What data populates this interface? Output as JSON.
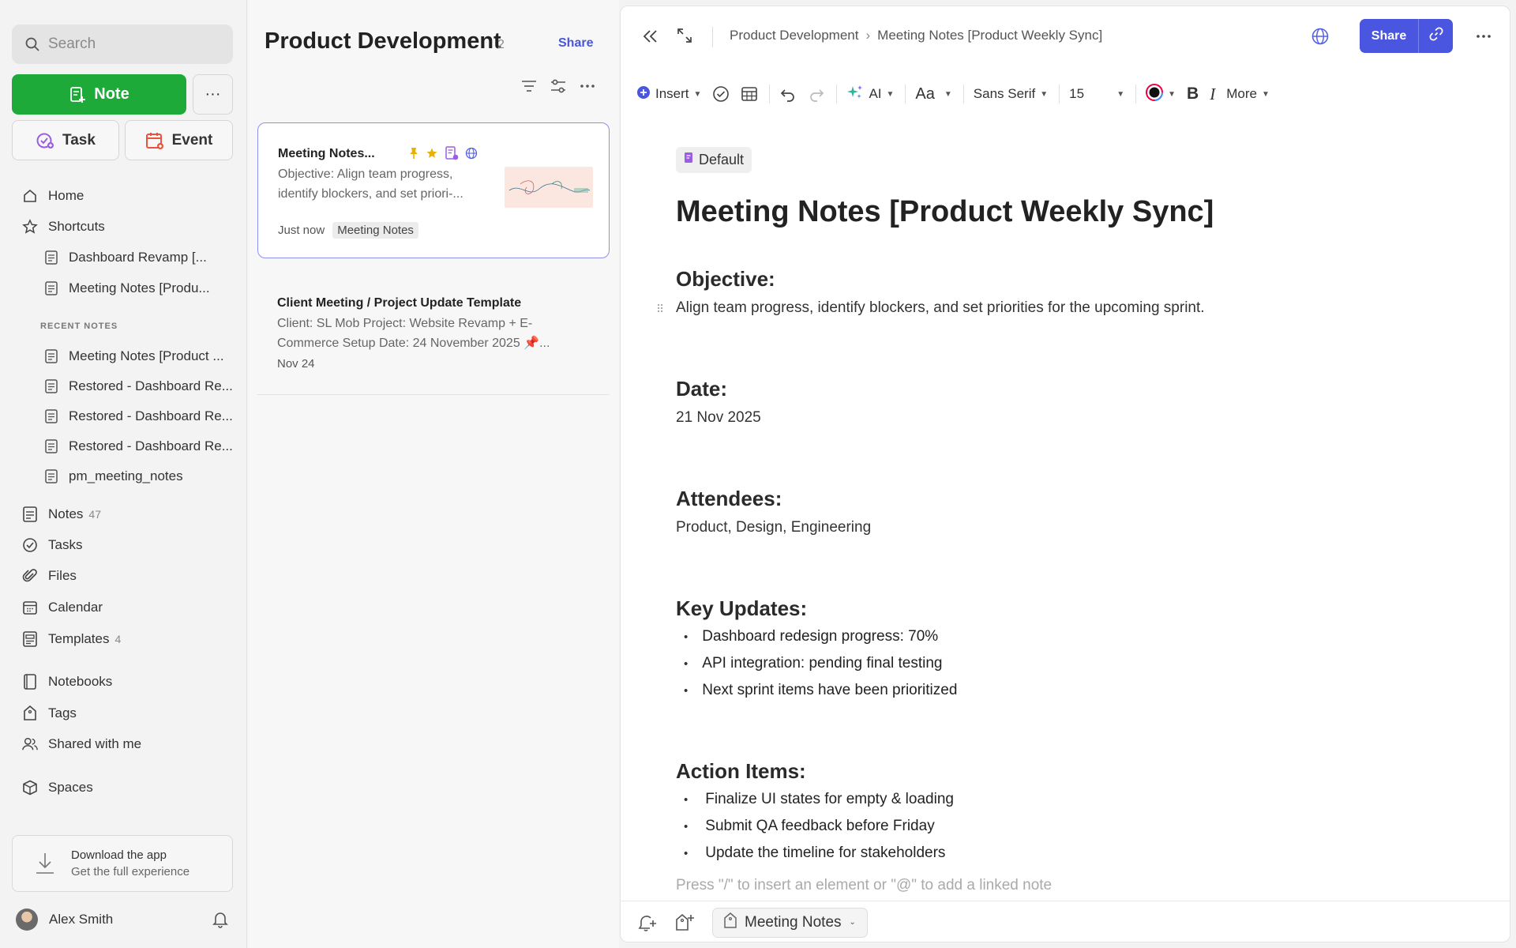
{
  "sidebar": {
    "search_placeholder": "Search",
    "note_button": "Note",
    "more_button": "···",
    "task_button": "Task",
    "event_button": "Event",
    "nav_top": [
      {
        "label": "Home",
        "icon": "home-icon"
      },
      {
        "label": "Shortcuts",
        "icon": "star-icon"
      }
    ],
    "shortcuts": [
      "Dashboard Revamp [...",
      "Meeting Notes [Produ..."
    ],
    "recent_title": "RECENT NOTES",
    "recent": [
      "Meeting Notes [Product ...",
      "Restored - Dashboard Re...",
      "Restored - Dashboard Re...",
      "Restored - Dashboard Re...",
      "pm_meeting_notes"
    ],
    "nav_main": [
      {
        "label": "Notes",
        "count": "47",
        "icon": "notes-icon"
      },
      {
        "label": "Tasks",
        "count": "",
        "icon": "task-check-icon"
      },
      {
        "label": "Files",
        "count": "",
        "icon": "paperclip-icon"
      },
      {
        "label": "Calendar",
        "count": "",
        "icon": "calendar-icon"
      },
      {
        "label": "Templates",
        "count": "4",
        "icon": "template-icon"
      }
    ],
    "nav_bottom": [
      {
        "label": "Notebooks",
        "icon": "notebook-icon"
      },
      {
        "label": "Tags",
        "icon": "tag-icon"
      },
      {
        "label": "Shared with me",
        "icon": "people-icon"
      },
      {
        "label": "Spaces",
        "icon": "cube-icon"
      }
    ],
    "download_title": "Download the app",
    "download_sub": "Get the full experience",
    "user_name": "Alex Smith"
  },
  "notelist": {
    "title": "Product Development",
    "count": "2",
    "share": "Share",
    "cards": [
      {
        "title": "Meeting Notes...",
        "snippet": "Objective: Align team progress, identify blockers, and set priori-...",
        "time": "Just now",
        "tag": "Meeting Notes"
      },
      {
        "title": "Client Meeting / Project Update Template",
        "snippet": "Client: SL Mob Project: Website Revamp + E-Commerce Setup Date: 24 November 2025 📌...",
        "time": "Nov 24"
      }
    ]
  },
  "editor": {
    "breadcrumb": [
      "Product Development",
      "Meeting Notes [Product Weekly Sync]"
    ],
    "share": "Share",
    "toolbar": {
      "insert": "Insert",
      "ai": "AI",
      "font_size_icon": "Aa",
      "font": "Sans Serif",
      "size": "15",
      "bold": "B",
      "italic": "I",
      "more": "More"
    },
    "template_chip": "Default",
    "title": "Meeting Notes [Product Weekly Sync]",
    "objective_heading": "Objective:",
    "objective_text": "Align team progress, identify blockers, and set priorities for the upcoming sprint.",
    "date_heading": "Date:",
    "date_text": "21 Nov 2025",
    "attendees_heading": "Attendees:",
    "attendees_text": "Product, Design, Engineering",
    "key_updates_heading": "Key Updates:",
    "key_updates": [
      "Dashboard redesign progress: 70%",
      "API integration: pending final testing",
      "Next sprint items have been prioritized"
    ],
    "action_items_heading": "Action Items:",
    "action_items": [
      "Finalize UI states for empty & loading",
      "Submit QA feedback before Friday",
      "Update the timeline for stakeholders"
    ],
    "hint": "Press \"/\" to insert an element or \"@\" to add a linked note",
    "notebook": "Meeting Notes"
  },
  "colors": {
    "note_green": "#1eaa39",
    "accent_blue": "#4a55e0",
    "active_border": "#8a92f0"
  }
}
